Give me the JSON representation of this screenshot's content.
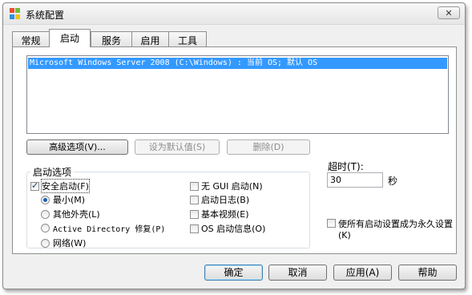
{
  "window": {
    "title": "系统配置"
  },
  "tabs": [
    {
      "label": "常规"
    },
    {
      "label": "启动"
    },
    {
      "label": "服务"
    },
    {
      "label": "启用"
    },
    {
      "label": "工具"
    }
  ],
  "boot_list": {
    "items": [
      {
        "text": "Microsoft Windows Server 2008 (C:\\Windows) : 当前 OS; 默认 OS",
        "selected": true
      }
    ]
  },
  "list_buttons": {
    "advanced": "高级选项(V)...",
    "set_default": "设为默认值(S)",
    "delete": "删除(D)"
  },
  "boot_options": {
    "legend": "启动选项",
    "safe_boot": {
      "label": "安全启动(F)",
      "checked": true
    },
    "minimal": {
      "label": "最小(M)",
      "checked": true
    },
    "alternate_shell": {
      "label": "其他外壳(L)",
      "checked": false
    },
    "active_directory_repair": {
      "label": "Active Directory 修复(P)",
      "checked": false
    },
    "network": {
      "label": "网络(W)",
      "checked": false
    },
    "no_gui_boot": {
      "label": "无 GUI 启动(N)",
      "checked": false
    },
    "boot_log": {
      "label": "启动日志(B)",
      "checked": false
    },
    "base_video": {
      "label": "基本视频(E)",
      "checked": false
    },
    "os_boot_info": {
      "label": "OS 启动信息(O)",
      "checked": false
    }
  },
  "timeout": {
    "label": "超时(T):",
    "value": "30",
    "unit": "秒"
  },
  "make_permanent": {
    "label": "使所有启动设置成为永久设置(K)",
    "checked": false
  },
  "dialog_buttons": {
    "ok": "确定",
    "cancel": "取消",
    "apply": "应用(A)",
    "help": "帮助"
  },
  "colors": {
    "selection": "#3399ff",
    "window_bg": "#f0f0f0",
    "panel_bg": "#ffffff"
  }
}
